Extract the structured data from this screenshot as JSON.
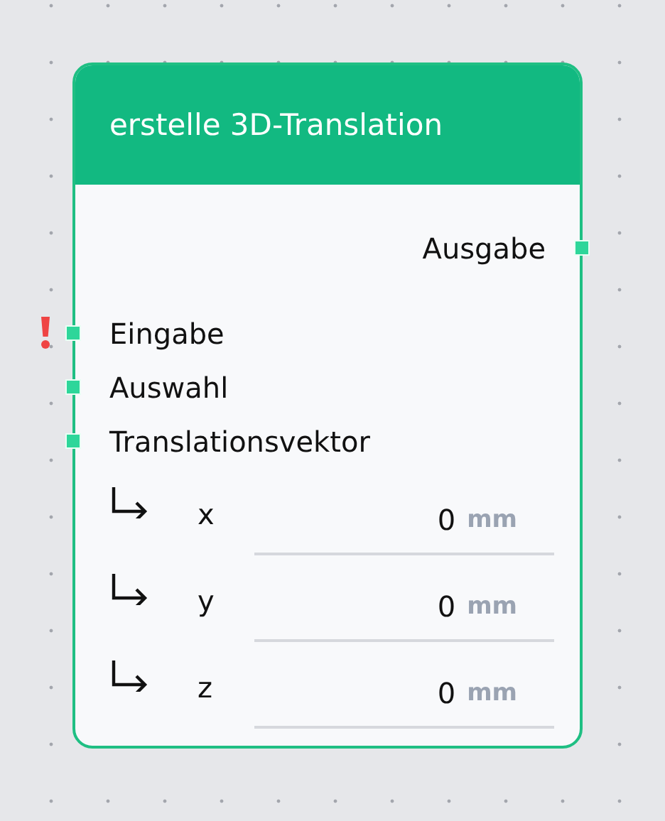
{
  "node": {
    "title": "erstelle 3D-Translation",
    "outputs": [
      {
        "label": "Ausgabe"
      }
    ],
    "inputs": [
      {
        "label": "Eingabe",
        "error": true
      },
      {
        "label": "Auswahl",
        "error": false
      },
      {
        "label": "Translationsvektor",
        "error": false
      }
    ],
    "fields": [
      {
        "label": "x",
        "value": "0",
        "unit": "mm"
      },
      {
        "label": "y",
        "value": "0",
        "unit": "mm"
      },
      {
        "label": "z",
        "value": "0",
        "unit": "mm"
      }
    ]
  }
}
